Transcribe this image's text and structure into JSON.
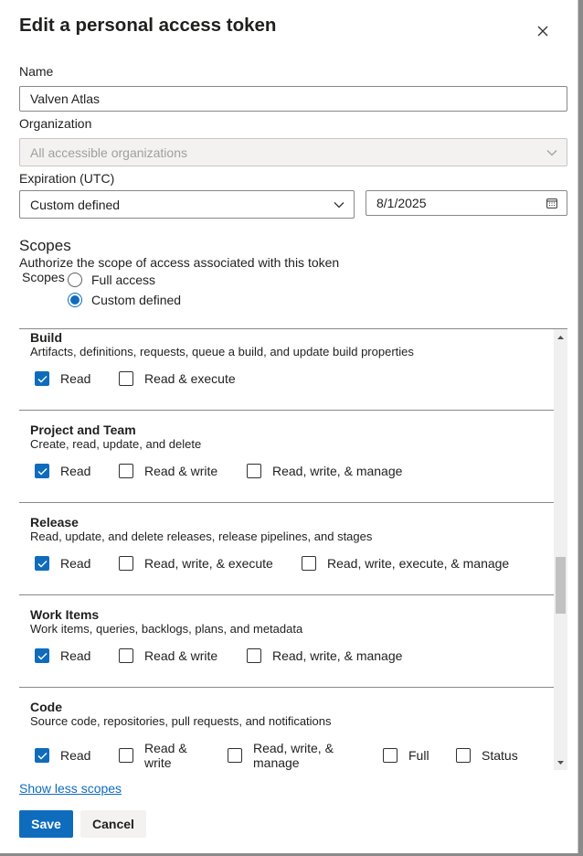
{
  "dialog": {
    "title": "Edit a personal access token",
    "close_icon": "close-icon"
  },
  "form": {
    "name_label": "Name",
    "name_value": "Valven Atlas",
    "org_label": "Organization",
    "org_value": "All accessible organizations",
    "expiration_label": "Expiration (UTC)",
    "expiration_value": "Custom defined",
    "date_value": "8/1/2025",
    "date_icon": "calendar-icon"
  },
  "scopes_section": {
    "heading": "Scopes",
    "description": "Authorize the scope of access associated with this token",
    "label": "Scopes",
    "radios": [
      {
        "label": "Full access",
        "selected": false
      },
      {
        "label": "Custom defined",
        "selected": true
      }
    ]
  },
  "scope_groups": [
    {
      "name": "Build",
      "description": "Artifacts, definitions, requests, queue a build, and update build properties",
      "options": [
        {
          "label": "Read",
          "checked": true
        },
        {
          "label": "Read & execute",
          "checked": false
        }
      ]
    },
    {
      "name": "Project and Team",
      "description": "Create, read, update, and delete",
      "options": [
        {
          "label": "Read",
          "checked": true
        },
        {
          "label": "Read & write",
          "checked": false
        },
        {
          "label": "Read, write, & manage",
          "checked": false
        }
      ]
    },
    {
      "name": "Release",
      "description": "Read, update, and delete releases, release pipelines, and stages",
      "options": [
        {
          "label": "Read",
          "checked": true
        },
        {
          "label": "Read, write, & execute",
          "checked": false
        },
        {
          "label": "Read, write, execute, & manage",
          "checked": false
        }
      ]
    },
    {
      "name": "Work Items",
      "description": "Work items, queries, backlogs, plans, and metadata",
      "options": [
        {
          "label": "Read",
          "checked": true
        },
        {
          "label": "Read & write",
          "checked": false
        },
        {
          "label": "Read, write, & manage",
          "checked": false
        }
      ]
    },
    {
      "name": "Code",
      "description": "Source code, repositories, pull requests, and notifications",
      "options": [
        {
          "label": "Read",
          "checked": true
        },
        {
          "label": "Read & write",
          "checked": false
        },
        {
          "label": "Read, write, & manage",
          "checked": false
        },
        {
          "label": "Full",
          "checked": false
        },
        {
          "label": "Status",
          "checked": false
        }
      ]
    }
  ],
  "footer": {
    "toggle_link": "Show less scopes",
    "save_label": "Save",
    "cancel_label": "Cancel"
  },
  "colors": {
    "accent": "#0f6cbd",
    "overlay": "#8a8a8a"
  }
}
